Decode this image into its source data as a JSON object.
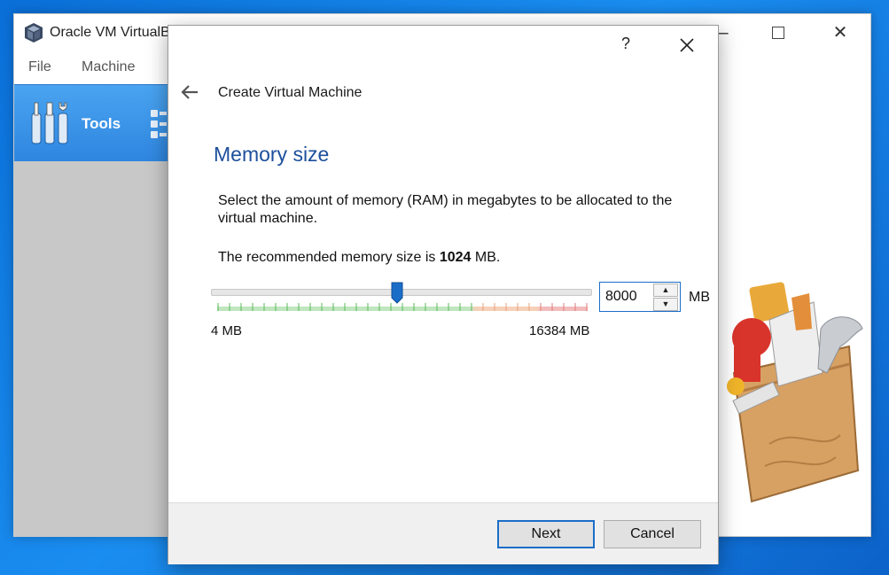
{
  "vbox": {
    "title": "Oracle VM VirtualBox Manager",
    "menu": [
      "File",
      "Machine"
    ],
    "tools_label": "Tools"
  },
  "dialog": {
    "help": "?",
    "title": "Create Virtual Machine",
    "heading": "Memory size",
    "description": "Select the amount of memory (RAM) in megabytes to be allocated to the virtual machine.",
    "recommend_prefix": "The recommended memory size is ",
    "recommend_value": "1024",
    "recommend_suffix": " MB.",
    "slider": {
      "min": 4,
      "max": 16384,
      "value": 8000
    },
    "min_label": "4 MB",
    "max_label": "16384 MB",
    "memory_value": "8000",
    "unit": "MB",
    "next_label": "Next",
    "cancel_label": "Cancel"
  },
  "colors": {
    "accent": "#1b6ec8",
    "heading": "#1d4f9c",
    "tick_green": "#5ab85a",
    "tick_orange": "#e8a27a",
    "tick_red": "#e27a7a"
  }
}
